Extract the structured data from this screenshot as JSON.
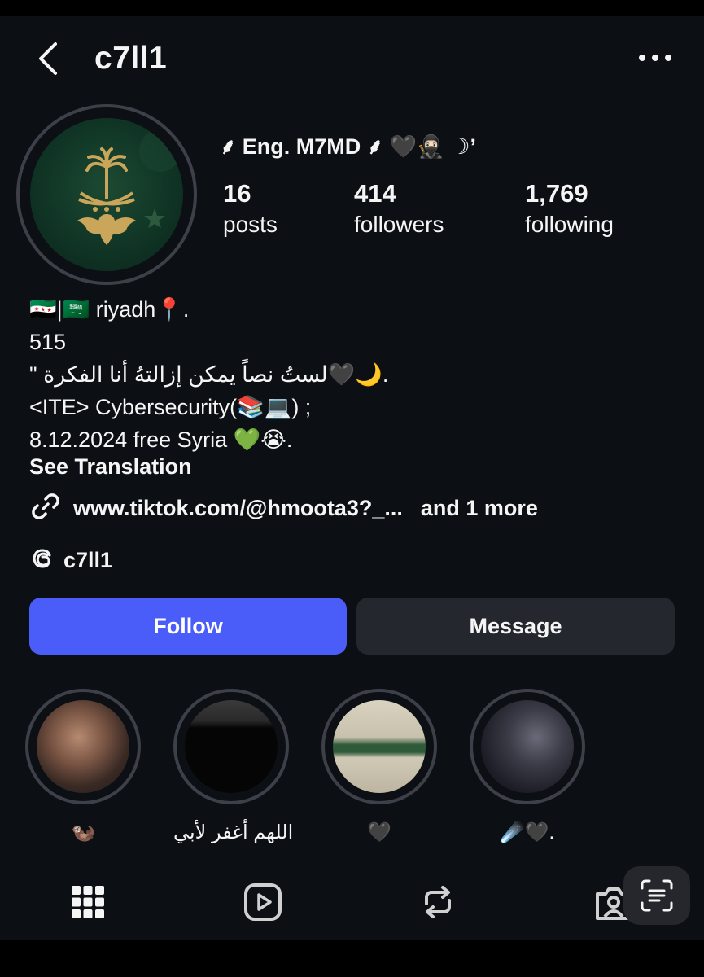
{
  "header": {
    "username": "c7ll1"
  },
  "profile": {
    "display_name": "⸙ Eng. M7MD ⸙ 🖤🥷🏻 ☽ʼ",
    "stats": [
      {
        "value": "16",
        "label": "posts"
      },
      {
        "value": "414",
        "label": "followers"
      },
      {
        "value": "1,769",
        "label": "following"
      }
    ]
  },
  "bio": {
    "lines": [
      "🇸🇾|🇸🇦 riyadh📍.",
      "515",
      "\" لستُ نصاً يمكن إزالتهُ أنا الفكرة🖤🌙.",
      "<ITE> Cybersecurity(📚💻) ;",
      "8.12.2024 free Syria 💚😭."
    ],
    "see_translation": "See Translation",
    "link_text": "www.tiktok.com/@hmoota3?_...",
    "link_more": "and 1 more",
    "threads_name": "c7ll1"
  },
  "buttons": {
    "follow": "Follow",
    "message": "Message"
  },
  "highlights": [
    {
      "label": "🦦"
    },
    {
      "label": "اللهم أغفر لأبي"
    },
    {
      "label": "🖤"
    },
    {
      "label": "☄️🖤."
    }
  ],
  "tabs": [
    "grid-icon",
    "reels-icon",
    "reposts-icon",
    "tagged-icon"
  ],
  "colors": {
    "background": "#0c0f14",
    "follow_button": "#4a5df9",
    "message_button": "#24272e"
  }
}
